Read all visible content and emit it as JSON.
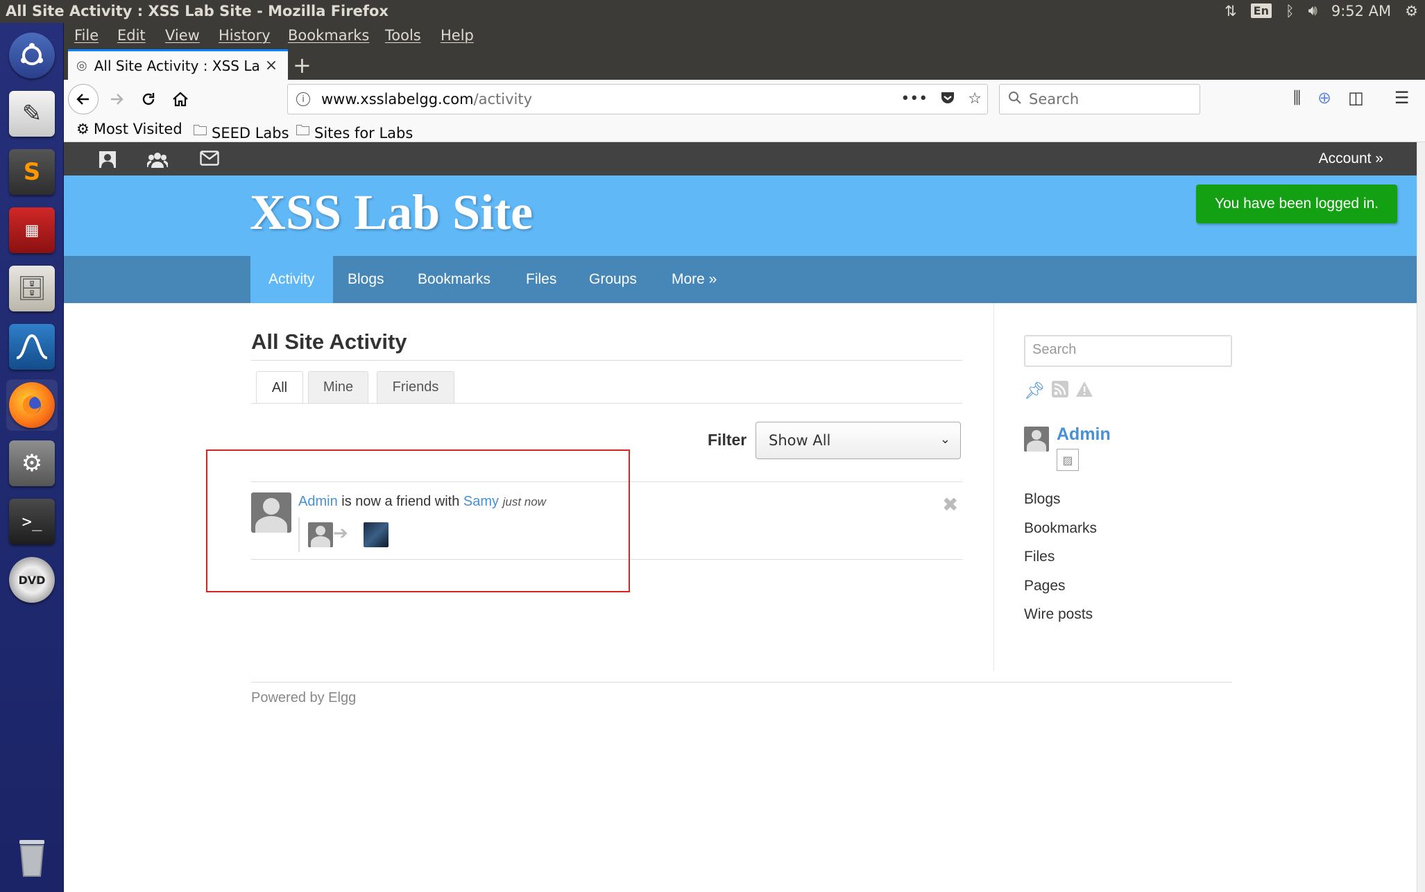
{
  "os": {
    "window_title": "All Site Activity : XSS Lab Site - Mozilla Firefox",
    "keyboard_indicator": "En",
    "clock": "9:52 AM"
  },
  "launcher": {
    "items": [
      "dash",
      "text-editor",
      "sublime-text",
      "system-monitor",
      "files",
      "wireshark",
      "firefox",
      "settings",
      "terminal",
      "dvd",
      "trash"
    ]
  },
  "menubar": {
    "items": [
      "File",
      "Edit",
      "View",
      "History",
      "Bookmarks",
      "Tools",
      "Help"
    ]
  },
  "tab": {
    "title": "All Site Activity : XSS Lab",
    "close_glyph": "×",
    "new_tab_glyph": "+"
  },
  "urlbar": {
    "host": "www.xsslabelgg.com",
    "path": "/activity",
    "overflow": "•••"
  },
  "searchbar": {
    "placeholder": "Search"
  },
  "bookmarks": {
    "items": [
      "Most Visited",
      "SEED Labs",
      "Sites for Labs"
    ]
  },
  "elgg_topbar": {
    "account_label": "Account »"
  },
  "header": {
    "site_title": "XSS Lab Site",
    "system_message": "You have been logged in."
  },
  "site_nav": {
    "items": [
      "Activity",
      "Blogs",
      "Bookmarks",
      "Files",
      "Groups",
      "More »"
    ],
    "active_index": 0
  },
  "main": {
    "title": "All Site Activity",
    "tabs": [
      "All",
      "Mine",
      "Friends"
    ],
    "active_tab": 0,
    "filter_label": "Filter",
    "filter_value": "Show All"
  },
  "activity": {
    "subject": "Admin",
    "verb": "is now a friend with",
    "object": "Samy",
    "time": "just now"
  },
  "sidebar": {
    "search_placeholder": "Search",
    "owner_name": "Admin",
    "links": [
      "Blogs",
      "Bookmarks",
      "Files",
      "Pages",
      "Wire posts"
    ]
  },
  "footer": {
    "text": "Powered by Elgg"
  },
  "colors": {
    "header_blue": "#60b8f7",
    "nav_blue": "#4787b8",
    "success_green": "#13a013",
    "link_blue": "#4690d6",
    "highlight_red": "#dd2222"
  }
}
